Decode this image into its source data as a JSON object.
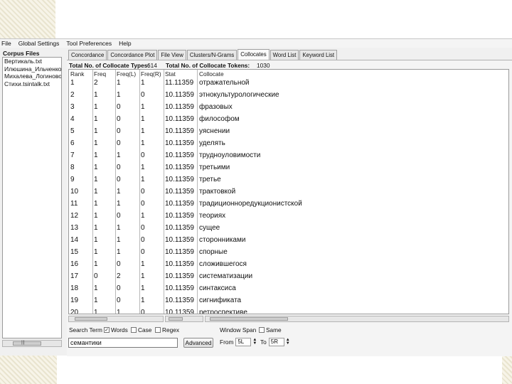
{
  "menu": [
    "File",
    "Global Settings",
    "Tool Preferences",
    "Help"
  ],
  "corpus": {
    "header": "Corpus Files",
    "files": [
      "Вертикаль.txt",
      "Илюшина_Ильченко_",
      "Михалева_Логиновой_",
      "Стихи.tsintalk.txt"
    ]
  },
  "tabs": [
    "Concordance",
    "Concordance Plot",
    "File View",
    "Clusters/N-Grams",
    "Collocates",
    "Word List",
    "Keyword List"
  ],
  "active_tab": "Collocates",
  "totals": {
    "types_label": "Total No. of Collocate Types:",
    "types_value": "614",
    "tokens_label": "Total No. of Collocate Tokens:",
    "tokens_value": "1030"
  },
  "columns": [
    "Rank",
    "Freq",
    "Freq(L)",
    "Freq(R)",
    "Stat",
    "Collocate"
  ],
  "rows": [
    {
      "rank": "1",
      "freq": "2",
      "freq_l": "1",
      "freq_r": "1",
      "stat": "11.11359",
      "collocate": "отражательной"
    },
    {
      "rank": "2",
      "freq": "1",
      "freq_l": "1",
      "freq_r": "0",
      "stat": "10.11359",
      "collocate": "этнокультурологические"
    },
    {
      "rank": "3",
      "freq": "1",
      "freq_l": "0",
      "freq_r": "1",
      "stat": "10.11359",
      "collocate": "фразовых"
    },
    {
      "rank": "4",
      "freq": "1",
      "freq_l": "0",
      "freq_r": "1",
      "stat": "10.11359",
      "collocate": "философом"
    },
    {
      "rank": "5",
      "freq": "1",
      "freq_l": "0",
      "freq_r": "1",
      "stat": "10.11359",
      "collocate": "уяснении"
    },
    {
      "rank": "6",
      "freq": "1",
      "freq_l": "0",
      "freq_r": "1",
      "stat": "10.11359",
      "collocate": "уделять"
    },
    {
      "rank": "7",
      "freq": "1",
      "freq_l": "1",
      "freq_r": "0",
      "stat": "10.11359",
      "collocate": "трудноуловимости"
    },
    {
      "rank": "8",
      "freq": "1",
      "freq_l": "0",
      "freq_r": "1",
      "stat": "10.11359",
      "collocate": "третьими"
    },
    {
      "rank": "9",
      "freq": "1",
      "freq_l": "0",
      "freq_r": "1",
      "stat": "10.11359",
      "collocate": "третье"
    },
    {
      "rank": "10",
      "freq": "1",
      "freq_l": "1",
      "freq_r": "0",
      "stat": "10.11359",
      "collocate": "трактовкой"
    },
    {
      "rank": "11",
      "freq": "1",
      "freq_l": "1",
      "freq_r": "0",
      "stat": "10.11359",
      "collocate": "традиционноредукционистской"
    },
    {
      "rank": "12",
      "freq": "1",
      "freq_l": "0",
      "freq_r": "1",
      "stat": "10.11359",
      "collocate": "теориях"
    },
    {
      "rank": "13",
      "freq": "1",
      "freq_l": "1",
      "freq_r": "0",
      "stat": "10.11359",
      "collocate": "сущее"
    },
    {
      "rank": "14",
      "freq": "1",
      "freq_l": "1",
      "freq_r": "0",
      "stat": "10.11359",
      "collocate": "сторонниками"
    },
    {
      "rank": "15",
      "freq": "1",
      "freq_l": "1",
      "freq_r": "0",
      "stat": "10.11359",
      "collocate": "спорные"
    },
    {
      "rank": "16",
      "freq": "1",
      "freq_l": "0",
      "freq_r": "1",
      "stat": "10.11359",
      "collocate": "сложившегося"
    },
    {
      "rank": "17",
      "freq": "0",
      "freq_l": "2",
      "freq_r": "1",
      "stat": "10.11359",
      "collocate": "систематизации"
    },
    {
      "rank": "18",
      "freq": "1",
      "freq_l": "0",
      "freq_r": "1",
      "stat": "10.11359",
      "collocate": "синтаксиса"
    },
    {
      "rank": "19",
      "freq": "1",
      "freq_l": "0",
      "freq_r": "1",
      "stat": "10.11359",
      "collocate": "сигнификата"
    },
    {
      "rank": "20",
      "freq": "1",
      "freq_l": "1",
      "freq_r": "0",
      "stat": "10.11359",
      "collocate": "ретроспективе"
    }
  ],
  "search": {
    "term_label": "Search Term",
    "words_label": "Words",
    "words_checked": true,
    "case_label": "Case",
    "case_checked": false,
    "regex_label": "Regex",
    "regex_checked": false,
    "value": "семантики",
    "advanced_label": "Advanced",
    "window_span_label": "Window Span",
    "same_label": "Same",
    "same_checked": false,
    "from_label": "From",
    "from_value": "5L",
    "to_label": "To",
    "to_value": "5R"
  }
}
